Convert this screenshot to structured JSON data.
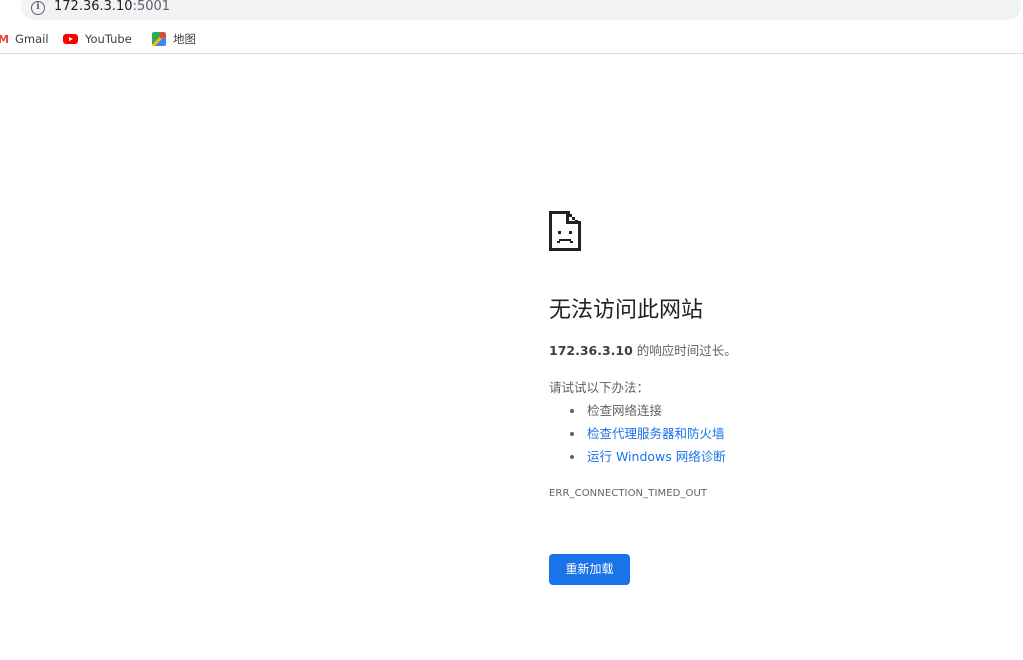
{
  "toolbar": {
    "back_icon": "back-arrow-icon",
    "url_host": "172.36.3.10",
    "url_port": ":5001"
  },
  "bookmarks": [
    {
      "label": "Gmail",
      "icon": "gmail-icon"
    },
    {
      "label": "YouTube",
      "icon": "youtube-icon"
    },
    {
      "label": "地图",
      "icon": "maps-icon"
    }
  ],
  "error": {
    "icon": "sad-page-icon",
    "title": "无法访问此网站",
    "host": "172.36.3.10",
    "desc_suffix": " 的响应时间过长。",
    "try_label": "请试试以下办法：",
    "suggestions": [
      {
        "text": "检查网络连接",
        "link": false
      },
      {
        "text": "检查代理服务器和防火墙",
        "link": true
      },
      {
        "text": "运行 Windows 网络诊断",
        "link": true
      }
    ],
    "code": "ERR_CONNECTION_TIMED_OUT",
    "reload_label": "重新加载"
  },
  "colors": {
    "accent": "#1a73e8",
    "text_secondary": "#5f6368"
  }
}
